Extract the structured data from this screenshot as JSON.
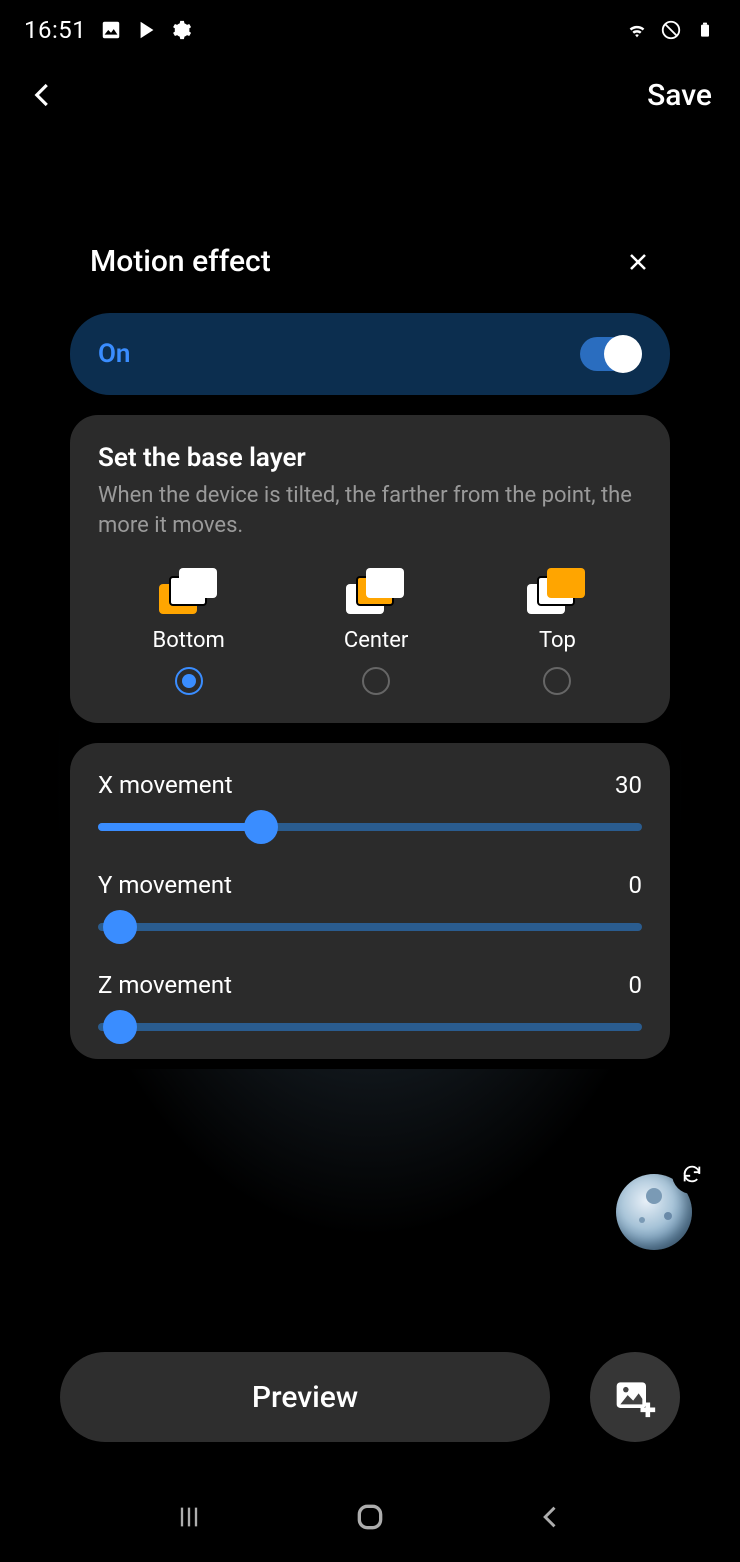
{
  "status": {
    "time": "16:51"
  },
  "top": {
    "save": "Save"
  },
  "card": {
    "title": "Motion effect",
    "toggle_label": "On"
  },
  "base_layer": {
    "title": "Set the base layer",
    "desc": "When the device is tilted, the farther from the point, the more it moves.",
    "options": [
      "Bottom",
      "Center",
      "Top"
    ]
  },
  "sliders": {
    "x": {
      "label": "X movement",
      "value": "30"
    },
    "y": {
      "label": "Y movement",
      "value": "0"
    },
    "z": {
      "label": "Z movement",
      "value": "0"
    }
  },
  "preview_label": "Preview",
  "colors": {
    "accent": "#3a8dff",
    "highlight": "#ffa500"
  }
}
